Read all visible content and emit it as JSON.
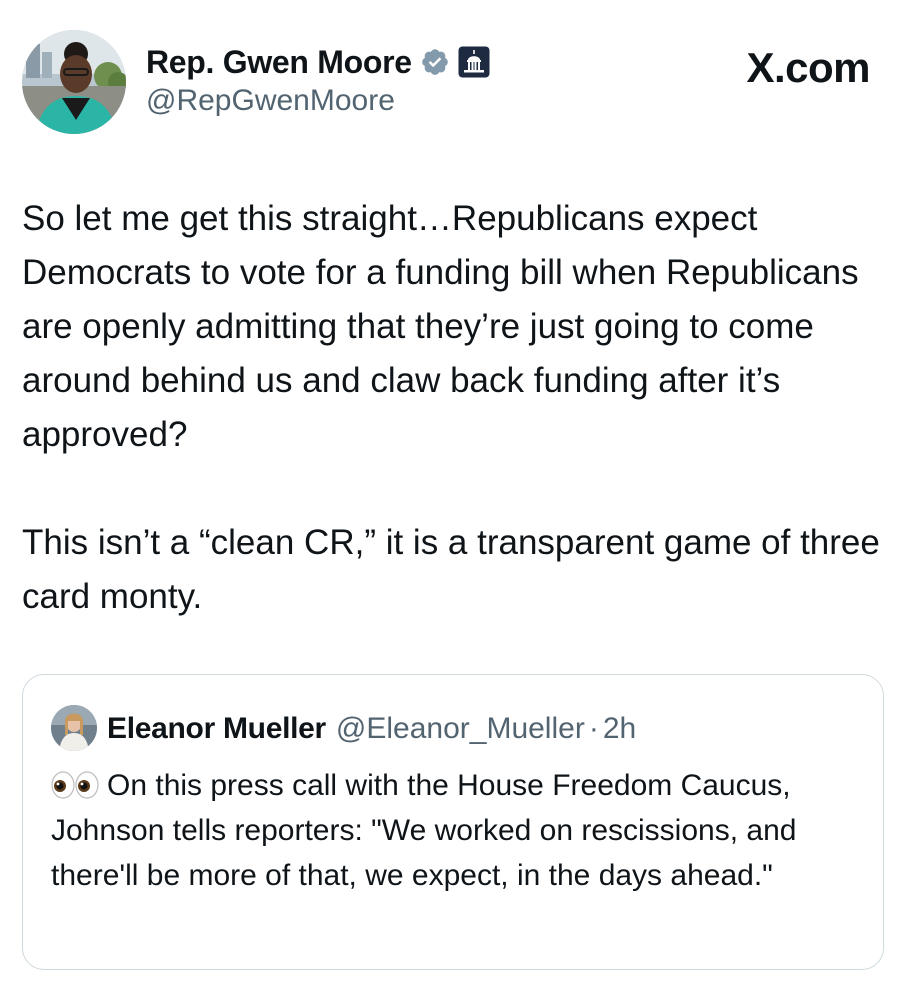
{
  "author": {
    "display_name": "Rep. Gwen Moore",
    "handle": "@RepGwenMoore",
    "avatar_icon": "profile-photo",
    "verified_icon": "verified-badge-icon",
    "affiliation_icon": "capitol-building-icon"
  },
  "brand": {
    "label": "X.com"
  },
  "tweet": {
    "paragraph1": "So let me get this straight…Republicans expect Democrats to vote for a funding bill when Republicans are openly admitting that they’re just going to come around behind us and claw back funding after it’s approved?",
    "paragraph2": "This isn’t a “clean CR,” it is a transparent game of three card monty."
  },
  "quoted_tweet": {
    "display_name": "Eleanor Mueller",
    "handle": "@Eleanor_Mueller",
    "separator": "·",
    "time": "2h",
    "emoji_icon": "eyes-emoji-icon",
    "text": "On this press call with the House Freedom Caucus, Johnson tells reporters: \"We worked on rescissions, and there'll be more of that, we expect, in the days ahead.\""
  },
  "colors": {
    "text_primary": "#0f1419",
    "text_secondary": "#536471",
    "verified_badge": "#829aab",
    "border": "#cfd9de"
  }
}
